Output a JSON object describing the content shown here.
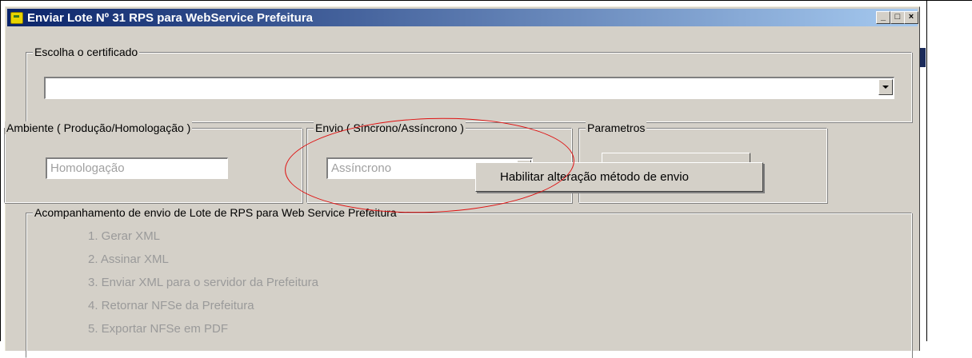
{
  "window": {
    "title": "Enviar Lote Nº 31 RPS para WebService Prefeitura",
    "minimize": "_",
    "maximize": "□",
    "close": "×"
  },
  "certificate": {
    "legend": "Escolha o certificado",
    "value": ""
  },
  "ambiente": {
    "legend": "Ambiente ( Produção/Homologação )",
    "value": "Homologação"
  },
  "envio": {
    "legend": "Envio ( Síncrono/Assíncrono )",
    "value": "Assíncrono"
  },
  "parametros": {
    "legend": "Parametros"
  },
  "context_menu": {
    "items": [
      "Habilitar alteração método de envio"
    ]
  },
  "progress": {
    "legend": "Acompanhamento de envio de Lote de RPS para Web Service Prefeitura",
    "steps": [
      "1. Gerar XML",
      "2. Assinar XML",
      "3. Enviar XML para o servidor da Prefeitura",
      "4. Retornar NFSe da Prefeitura",
      "5. Exportar NFSe em PDF"
    ]
  },
  "colors": {
    "title_gradient_start": "#0a246a",
    "title_gradient_end": "#a6caf0",
    "window_face": "#d4d0c8",
    "annotation": "#e01010"
  }
}
